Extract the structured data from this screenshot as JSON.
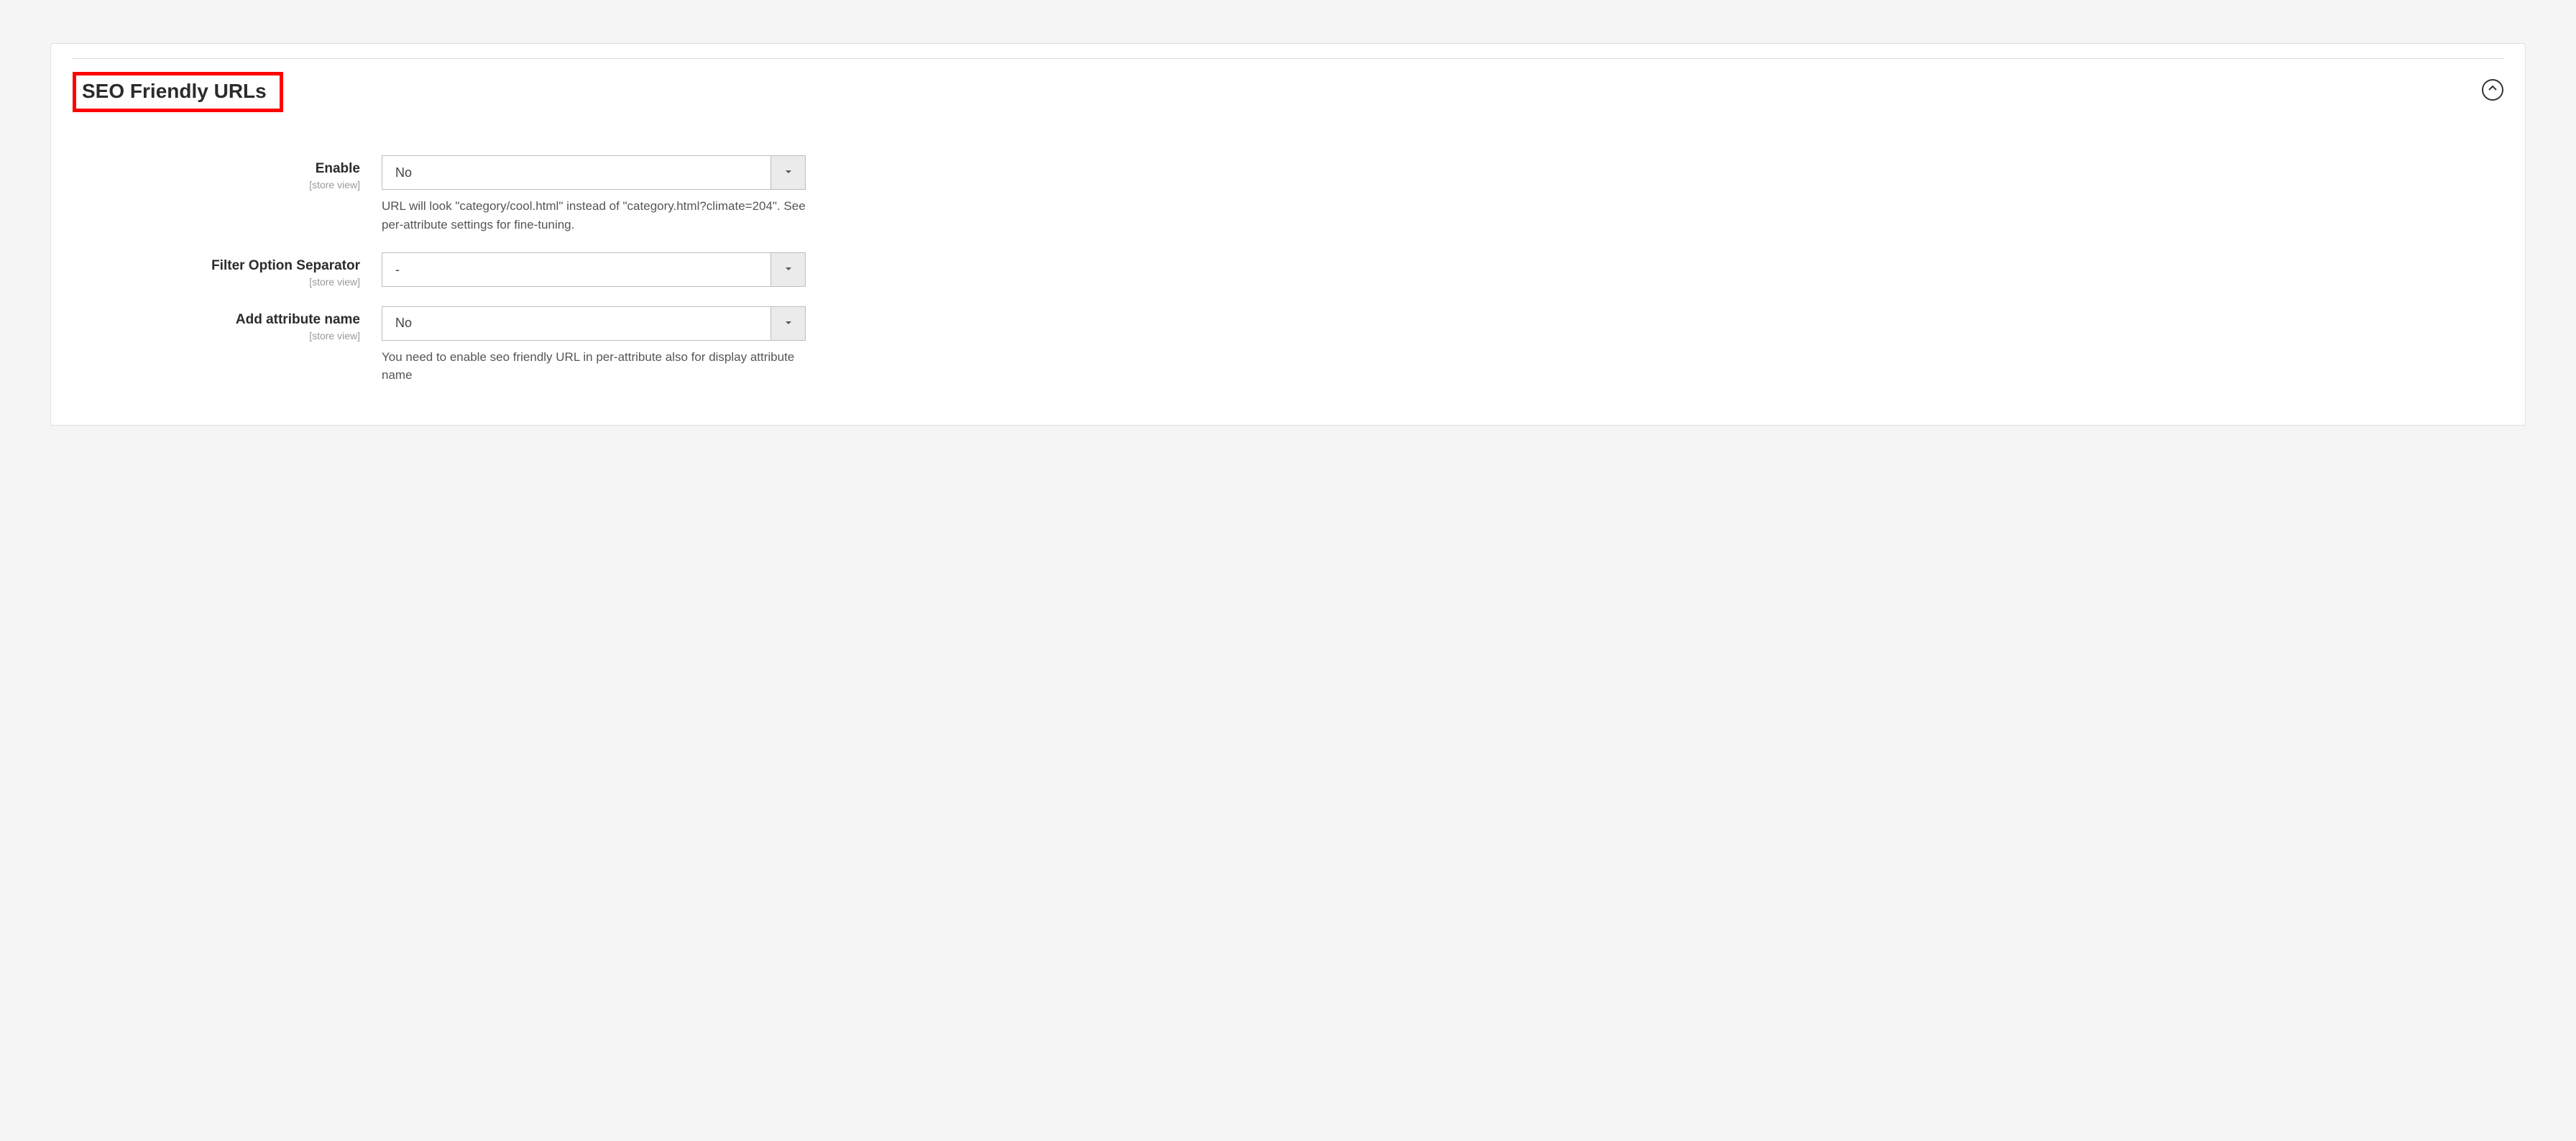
{
  "section": {
    "title": "SEO Friendly URLs",
    "scope_label": "[store view]",
    "fields": {
      "enable": {
        "label": "Enable",
        "value": "No",
        "help": "URL will look \"category/cool.html\" instead of \"category.html?climate=204\". See per-attribute settings for fine-tuning."
      },
      "separator": {
        "label": "Filter Option Separator",
        "value": "-"
      },
      "attr_name": {
        "label": "Add attribute name",
        "value": "No",
        "help": "You need to enable seo friendly URL in per-attribute also for display attribute name"
      }
    }
  }
}
